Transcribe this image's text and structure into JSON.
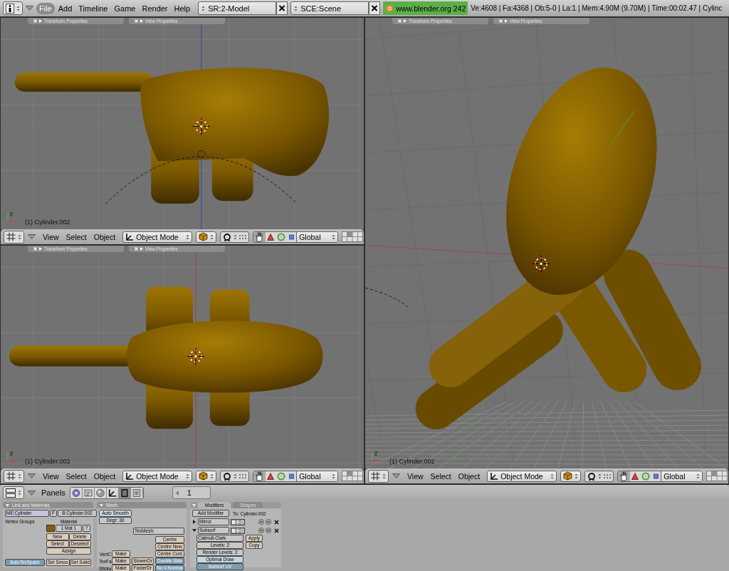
{
  "top_bar": {
    "menus": [
      {
        "label": "File",
        "selected": true
      },
      {
        "label": "Add",
        "selected": false
      },
      {
        "label": "Timeline",
        "selected": false
      },
      {
        "label": "Game",
        "selected": false
      },
      {
        "label": "Render",
        "selected": false
      },
      {
        "label": "Help",
        "selected": false
      }
    ],
    "screen": "SR:2-Model",
    "scene": "SCE:Scene",
    "version": "www.blender.org 242",
    "stats": "Ve:4608 | Fa:4368 | Ob:5-0 | La:1  | Mem:4.90M (9.70M)  | Time:00:02.47 | Cylinc"
  },
  "viewports": [
    {
      "panels": [
        "Transform Properties",
        "View Properties"
      ],
      "object_label": "(1) Cylinder.002",
      "menus": [
        "View",
        "Select",
        "Object"
      ],
      "mode": "Object Mode",
      "orientation": "Global"
    },
    {
      "panels": [
        "Transform Properties",
        "View Properties"
      ],
      "object_label": "(1) Cylinder.002",
      "menus": [
        "View",
        "Select",
        "Object"
      ],
      "mode": "Object Mode",
      "orientation": "Global"
    },
    {
      "panels": [
        "Transform Properties",
        "View Properties"
      ],
      "object_label": "(1) Cylinder.002",
      "menus": [
        "View",
        "Select",
        "Object"
      ],
      "mode": "Object Mode",
      "orientation": "Global"
    }
  ],
  "buttons_window": {
    "header": {
      "label": "Panels",
      "contexts": [
        {
          "kind": "logic",
          "selected": false
        },
        {
          "kind": "script",
          "selected": false
        },
        {
          "kind": "shading",
          "selected": false
        },
        {
          "kind": "object",
          "selected": false
        },
        {
          "kind": "editing",
          "selected": true
        },
        {
          "kind": "scene",
          "selected": false
        }
      ],
      "frame": "1"
    },
    "link_materials": {
      "title": "Link and Materials",
      "mesh": "ME:Cylinder",
      "fake": "F",
      "object": "B:Cylinder.002",
      "vertex_groups": "Vertex Groups",
      "material_label": "Material",
      "material": "1 Mat 1",
      "material_help": "?",
      "buttons": [
        "New",
        "Delete",
        "Select",
        "Deselect",
        "Assign"
      ],
      "autotexspace": {
        "label": "AutoTexSpace",
        "on": true
      },
      "set_smooth": "Set Smoo",
      "set_solid": "Set Solid"
    },
    "mesh": {
      "title": "Mesh",
      "auto_smooth": "Auto Smooth",
      "degree": "Degr: 30",
      "texmesh": "TexMesh:",
      "centre": [
        "Centre",
        "Centre New",
        "Centre Curs"
      ],
      "make_rows": [
        {
          "label": "VertC",
          "button": "Make"
        },
        {
          "label": "TexFa",
          "button": "Make"
        },
        {
          "label": "Sticky",
          "button": "Make"
        }
      ],
      "draw_speed": [
        "SlowerDr",
        "FasterDr"
      ],
      "toggles": [
        {
          "label": "Double Side",
          "on": true
        },
        {
          "label": "No V.Normal",
          "on": true
        }
      ]
    },
    "modifiers": {
      "tabs": [
        {
          "label": "Modifiers",
          "selected": true
        },
        {
          "label": "Shapes",
          "selected": false
        }
      ],
      "add_button": "Add Modifier",
      "target": "To: Cylinder.002",
      "stack": [
        {
          "name": "Mirror",
          "expanded": false
        },
        {
          "name": "Subsurf",
          "expanded": true,
          "subdivision": "Catmull-Clark",
          "levels": "Levels: 2",
          "render_levels": "Render Levels: 2",
          "options": [
            {
              "label": "Optimal Draw",
              "on": false
            },
            {
              "label": "Subsurf UV",
              "on": true
            }
          ],
          "actions": [
            "Apply",
            "Copy"
          ]
        }
      ]
    }
  }
}
